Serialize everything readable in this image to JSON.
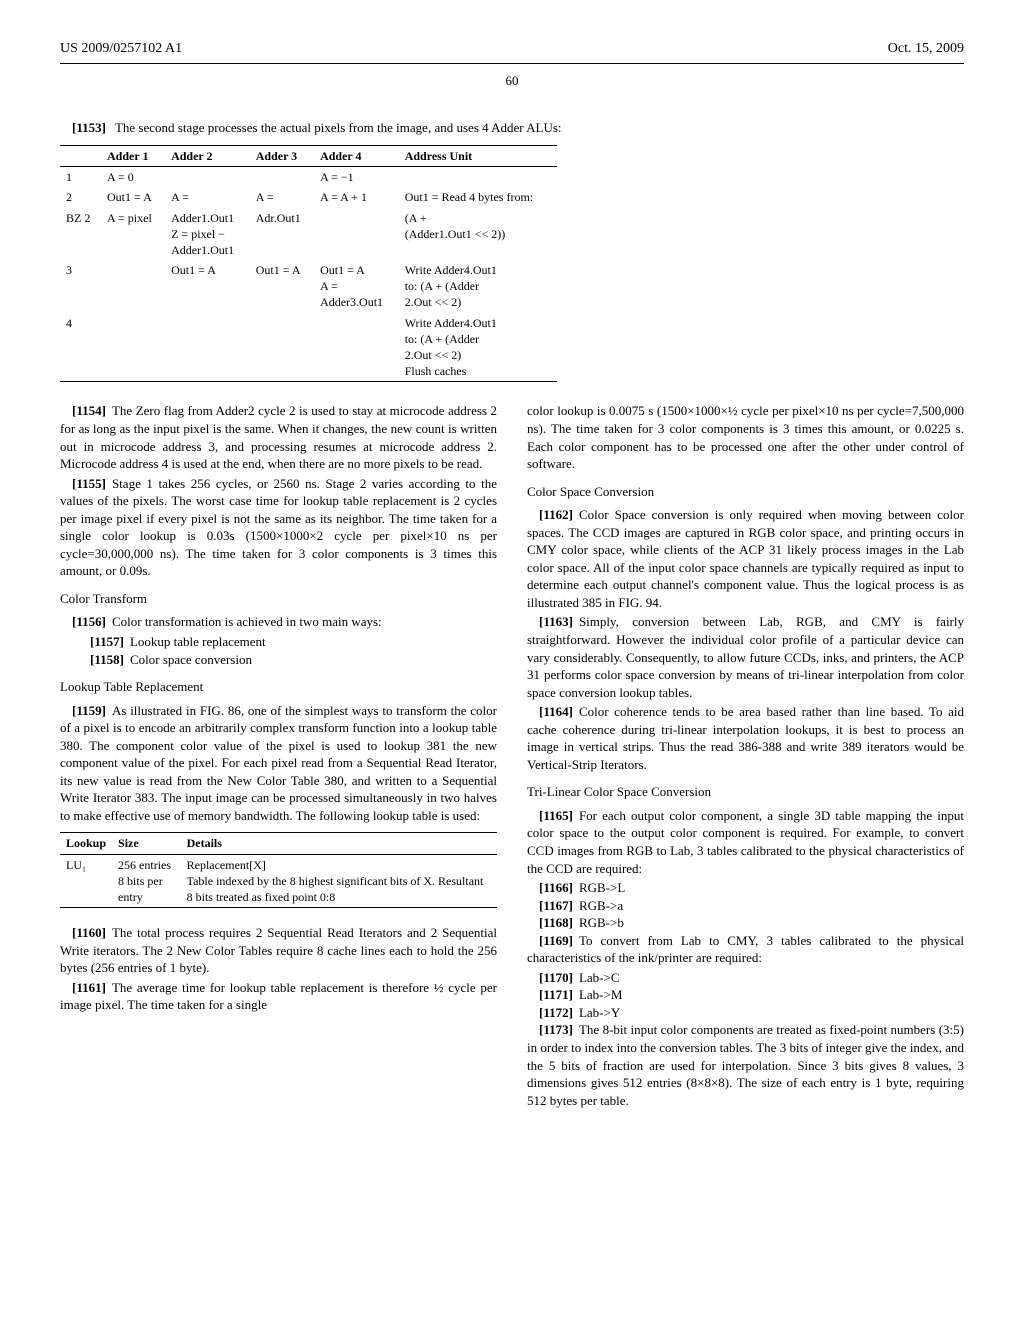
{
  "header": {
    "left": "US 2009/0257102 A1",
    "right": "Oct. 15, 2009"
  },
  "pageNumber": "60",
  "intro": {
    "p1153": "The second stage processes the actual pixels from the image, and uses 4 Adder ALUs:"
  },
  "table1": {
    "headers": [
      "",
      "Adder 1",
      "Adder 2",
      "Adder 3",
      "Adder 4",
      "Address Unit"
    ],
    "rows": [
      [
        "1",
        "A = 0",
        "",
        "",
        "A = −1",
        ""
      ],
      [
        "2",
        "Out1 = A",
        "A =",
        "A =",
        "A = A + 1",
        "Out1 = Read 4 bytes from:"
      ],
      [
        "BZ 2",
        "A = pixel",
        "Adder1.Out1\nZ = pixel −\nAdder1.Out1",
        "Adr.Out1",
        "",
        "(A +\n(Adder1.Out1 << 2))"
      ],
      [
        "3",
        "",
        "Out1 = A",
        "Out1 = A",
        "Out1 = A\nA =\nAdder3.Out1",
        "Write Adder4.Out1\nto: (A + (Adder\n2.Out << 2)"
      ],
      [
        "4",
        "",
        "",
        "",
        "",
        "Write Adder4.Out1\nto: (A + (Adder\n2.Out << 2)\nFlush caches"
      ]
    ]
  },
  "left": {
    "p1154": "The Zero flag from Adder2 cycle 2 is used to stay at microcode address 2 for as long as the input pixel is the same. When it changes, the new count is written out in microcode address 3, and processing resumes at microcode address 2. Microcode address 4 is used at the end, when there are no more pixels to be read.",
    "p1155": "Stage 1 takes 256 cycles, or 2560 ns. Stage 2 varies according to the values of the pixels. The worst case time for lookup table replacement is 2 cycles per image pixel if every pixel is not the same as its neighbor. The time taken for a single color lookup is 0.03s (1500×1000×2 cycle per pixel×10 ns per cycle=30,000,000 ns). The time taken for 3 color components is 3 times this amount, or 0.09s.",
    "h_colorTransform": "Color Transform",
    "p1156": "Color transformation is achieved in two main ways:",
    "p1157": "Lookup table replacement",
    "p1158": "Color space conversion",
    "h_lookup": "Lookup Table Replacement",
    "p1159": "As illustrated in FIG. 86, one of the simplest ways to transform the color of a pixel is to encode an arbitrarily complex transform function into a lookup table 380. The component color value of the pixel is used to lookup 381 the new component value of the pixel. For each pixel read from a Sequential Read Iterator, its new value is read from the New Color Table 380, and written to a Sequential Write Iterator 383. The input image can be processed simultaneously in two halves to make effective use of memory bandwidth. The following lookup table is used:",
    "p1160": "The total process requires 2 Sequential Read Iterators and 2 Sequential Write iterators. The 2 New Color Tables require 8 cache lines each to hold the 256 bytes (256 entries of 1 byte).",
    "p1161": "The average time for lookup table replacement is therefore ½ cycle per image pixel. The time taken for a single"
  },
  "lookupTable": {
    "headers": [
      "Lookup",
      "Size",
      "Details"
    ],
    "row": {
      "c1": "LU₁",
      "c2": "256 entries\n8 bits per entry",
      "c3": "Replacement[X]\nTable indexed by the 8 highest significant bits of X. Resultant 8 bits treated as fixed point 0:8"
    }
  },
  "right": {
    "cont": "color lookup is 0.0075 s (1500×1000×½ cycle per pixel×10 ns per cycle=7,500,000 ns). The time taken for 3 color components is 3 times this amount, or 0.0225 s. Each color component has to be processed one after the other under control of software.",
    "h_csc": "Color Space Conversion",
    "p1162": "Color Space conversion is only required when moving between color spaces. The CCD images are captured in RGB color space, and printing occurs in CMY color space, while clients of the ACP 31 likely process images in the Lab color space. All of the input color space channels are typically required as input to determine each output channel's component value. Thus the logical process is as illustrated 385 in FIG. 94.",
    "p1163": "Simply, conversion between Lab, RGB, and CMY is fairly straightforward. However the individual color profile of a particular device can vary considerably. Consequently, to allow future CCDs, inks, and printers, the ACP 31 performs color space conversion by means of tri-linear interpolation from color space conversion lookup tables.",
    "p1164": "Color coherence tends to be area based rather than line based. To aid cache coherence during tri-linear interpolation lookups, it is best to process an image in vertical strips. Thus the read 386-388 and write 389 iterators would be Vertical-Strip Iterators.",
    "h_tri": "Tri-Linear Color Space Conversion",
    "p1165": "For each output color component, a single 3D table mapping the input color space to the output color component is required. For example, to convert CCD images from RGB to Lab, 3 tables calibrated to the physical characteristics of the CCD are required:",
    "p1166": "RGB->L",
    "p1167": "RGB->a",
    "p1168": "RGB->b",
    "p1169": "To convert from Lab to CMY, 3 tables calibrated to the physical characteristics of the ink/printer are required:",
    "p1170": "Lab->C",
    "p1171": "Lab->M",
    "p1172": "Lab->Y",
    "p1173": "The 8-bit input color components are treated as fixed-point numbers (3:5) in order to index into the conversion tables. The 3 bits of integer give the index, and the 5 bits of fraction are used for interpolation. Since 3 bits gives 8 values, 3 dimensions gives 512 entries (8×8×8). The size of each entry is 1 byte, requiring 512 bytes per table."
  }
}
